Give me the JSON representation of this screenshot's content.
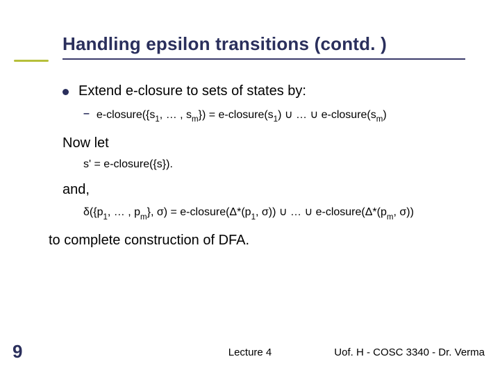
{
  "title": "Handling epsilon transitions (contd. )",
  "bullet1": "Extend e-closure to sets of states by:",
  "sub1_pre": "e-closure({s",
  "sub1_mid": ", … , s",
  "sub1_post": "}) = e-closure(s",
  "sub1_cup1": ") ∪ … ∪ e-closure(s",
  "sub1_end": ")",
  "nowlet": "Now let",
  "eq1": "s' = e-closure({s}).",
  "and": "and,",
  "delta_pre": "δ({p",
  "delta_mid1": ", … , p",
  "delta_mid2": "}, σ) = e-closure(Δ*(p",
  "delta_mid3": ", σ)) ∪ … ∪ e-closure(Δ*(p",
  "delta_end": ", σ))",
  "final": "to complete construction of DFA.",
  "pagenum": "9",
  "footer_center": "Lecture 4",
  "footer_right": "Uof. H - COSC 3340 - Dr. Verma",
  "idx_1": "1",
  "idx_m": "m"
}
